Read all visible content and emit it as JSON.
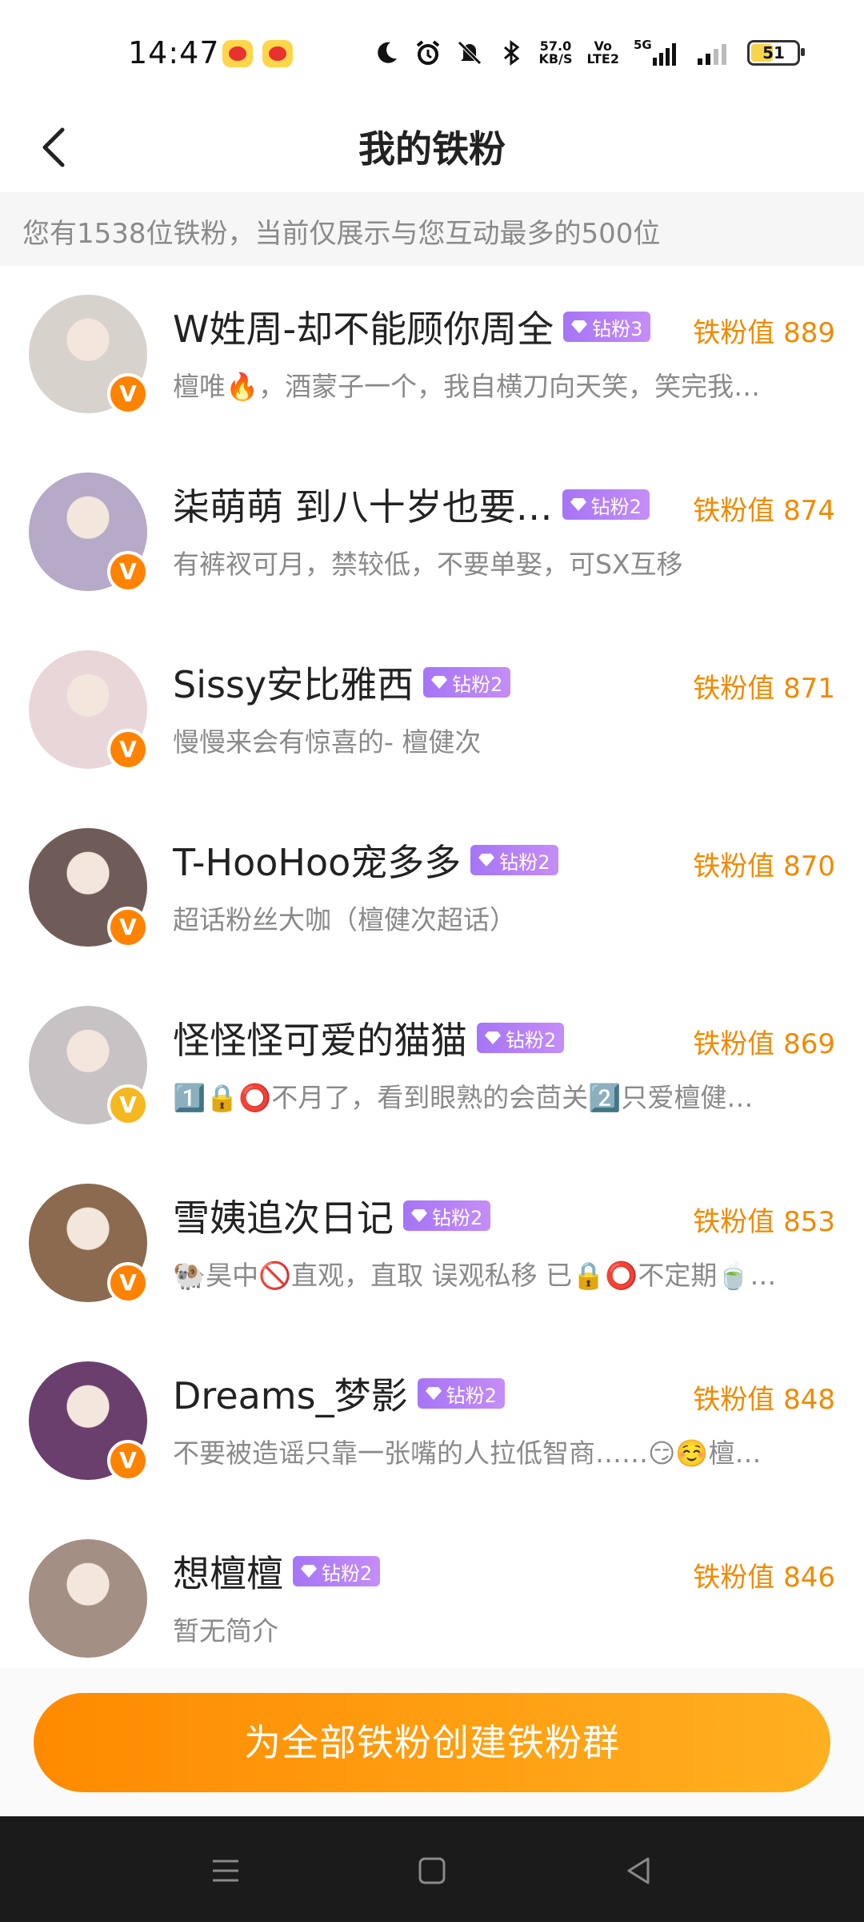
{
  "status_bar": {
    "time": "14:47",
    "net_speed_top": "57.0",
    "net_speed_bottom": "KB/S",
    "volte_top": "Vo",
    "volte_bottom": "LTE2",
    "signal_label": "5G",
    "battery": "51",
    "battery_level": 0.51,
    "icons": [
      "weibo-icon",
      "weibo-icon",
      "moon-icon",
      "alarm-icon",
      "mute-icon",
      "bluetooth-icon",
      "signal-icon"
    ]
  },
  "header": {
    "title": "我的铁粉"
  },
  "notice": "您有1538位铁粉，当前仅展示与您互动最多的500位",
  "fans": [
    {
      "name": "W姓周-却不能顾你周全",
      "badge": "钻粉3",
      "score": "铁粉值 889",
      "desc": "檀唯🔥，酒蒙子一个，我自横刀向天笑，笑完我…",
      "avatar_color": "#d8d2cc"
    },
    {
      "name": "柒萌萌 到八十岁也要…",
      "badge": "钻粉2",
      "score": "铁粉值 874",
      "desc": "有裤衩可月，禁较低，不要单娶，可SX互移",
      "avatar_color": "#b7a9c8"
    },
    {
      "name": "Sissy安比雅西",
      "badge": "钻粉2",
      "score": "铁粉值 871",
      "desc": "慢慢来会有惊喜的- 檀健次",
      "avatar_color": "#e9d6d8"
    },
    {
      "name": "T-HooHoo宠多多",
      "badge": "钻粉2",
      "score": "铁粉值 870",
      "desc": "超话粉丝大咖（檀健次超话）",
      "avatar_color": "#6f5b57"
    },
    {
      "name": "怪怪怪可爱的猫猫",
      "badge": "钻粉2",
      "score": "铁粉值 869",
      "desc": "1️⃣🔒⭕不月了，看到眼熟的会茴关2️⃣只爱檀健…",
      "avatar_color": "#c7c2c4"
    },
    {
      "name": "雪姨追次日记",
      "badge": "钻粉2",
      "score": "铁粉值 853",
      "desc": "🐏昊中🚫直观，直取 误观私移 已🔒⭕不定期🍵…",
      "avatar_color": "#8b6a4f"
    },
    {
      "name": "Dreams_梦影",
      "badge": "钻粉2",
      "score": "铁粉值 848",
      "desc": "不要被造谣只靠一张嘴的人拉低智商……😏☺️檀…",
      "avatar_color": "#6a3f6e"
    },
    {
      "name": "想檀檀",
      "badge": "钻粉2",
      "score": "铁粉值 846",
      "desc": "暂无简介",
      "avatar_color": "#a48f84"
    }
  ],
  "cta_label": "为全部铁粉创建铁粉群",
  "nav": {
    "icons": [
      "menu-icon",
      "home-square-icon",
      "back-triangle-icon"
    ]
  }
}
